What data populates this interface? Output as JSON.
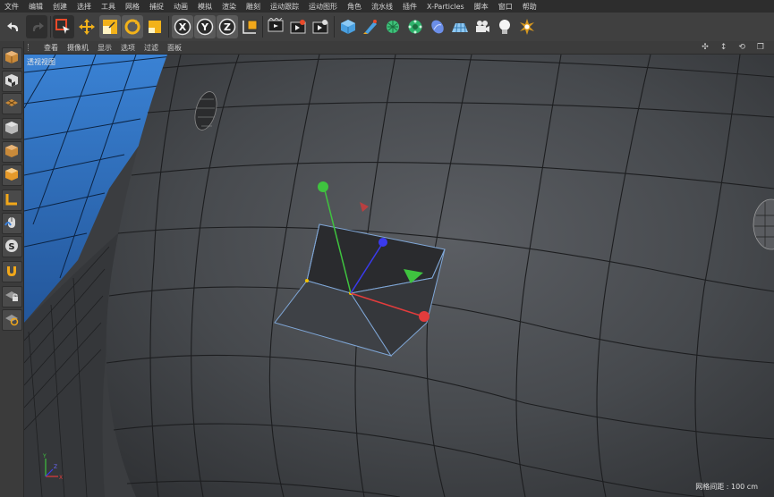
{
  "menu": [
    "文件",
    "编辑",
    "创建",
    "选择",
    "工具",
    "网格",
    "捕捉",
    "动画",
    "模拟",
    "渲染",
    "雕刻",
    "运动跟踪",
    "运动图形",
    "角色",
    "流水线",
    "插件",
    "X-Particles",
    "脚本",
    "窗口",
    "帮助"
  ],
  "toolbar": {
    "tools": [
      "undo-icon",
      "redo-icon",
      "select-icon",
      "move-icon",
      "scale-icon",
      "rotate-icon",
      "recent-icon",
      "x-axis-icon",
      "y-axis-icon",
      "z-axis-icon",
      "coordinate-system-icon",
      "render-view-icon",
      "render-picture-queue-icon",
      "render-settings-icon",
      "cube-icon",
      "pen-icon",
      "subdivide-icon",
      "array-icon",
      "deformer-icon",
      "floor-icon",
      "camera-icon",
      "light-icon",
      "scene-icon"
    ],
    "axis_labels": {
      "x": "X",
      "y": "Y",
      "z": "Z"
    }
  },
  "viewport_menu": [
    "查看",
    "摄像机",
    "显示",
    "选项",
    "过滤",
    "面板"
  ],
  "viewport_controls": {
    "move": "✣",
    "dolly": "↕",
    "rotate": "⟲",
    "maximize": "❐"
  },
  "viewport": {
    "label": "透视视图",
    "grid_spacing": "网格间距 : 100 cm",
    "colors": {
      "surface": "#4a4c50",
      "background_sky": "#2e6bb3",
      "x_axis": "#e23c3c",
      "y_axis": "#3fc33f",
      "z_axis": "#3a3aee",
      "selection_edge": "#7fa6d6"
    }
  },
  "mini_axis": {
    "x": "X",
    "y": "Y",
    "z": "Z"
  }
}
